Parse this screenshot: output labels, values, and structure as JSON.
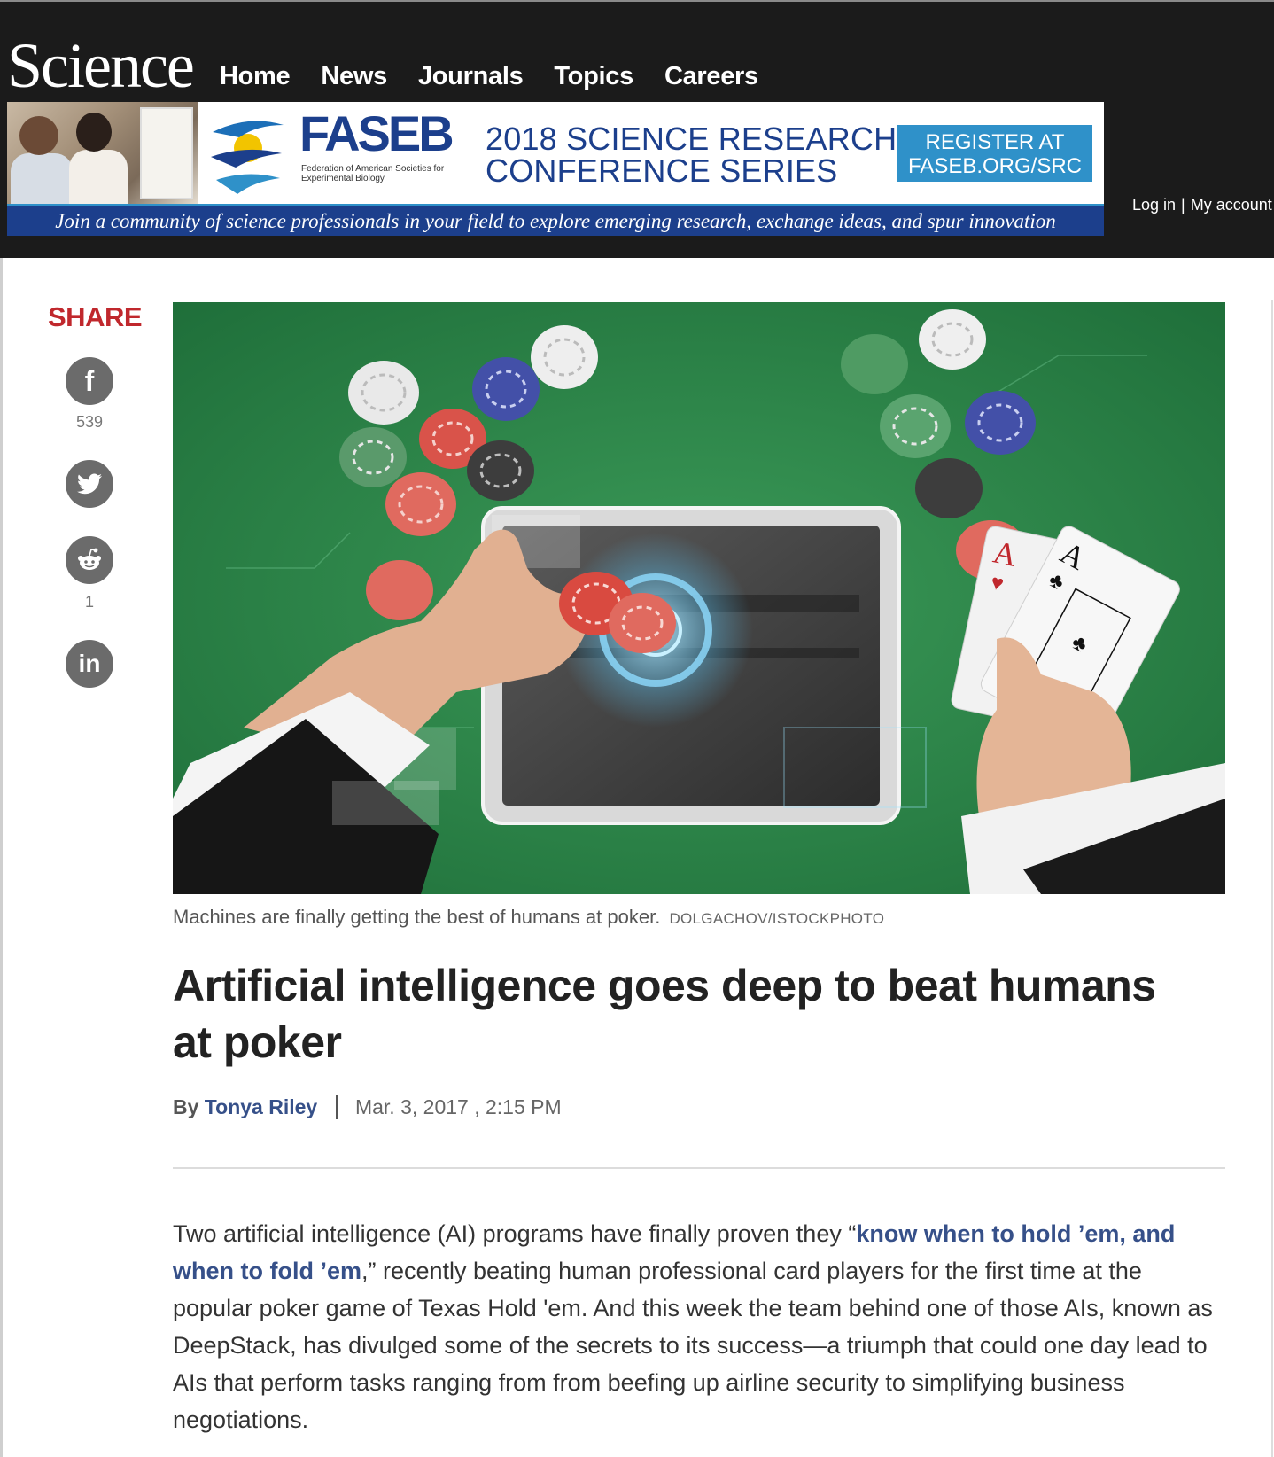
{
  "header": {
    "logo": "Science",
    "nav": [
      "Home",
      "News",
      "Journals",
      "Topics",
      "Careers"
    ],
    "login": "Log in",
    "separator": "|",
    "my_account": "My account"
  },
  "ad": {
    "brand": "FASEB",
    "brand_sub": "Federation of American Societies for Experimental Biology",
    "conference_line1": "2018 SCIENCE RESEARCH",
    "conference_line2": "CONFERENCE SERIES",
    "register_line1": "REGISTER AT",
    "register_line2": "FASEB.ORG/SRC",
    "tagline": "Join a community of science professionals in your field to explore emerging research, exchange ideas, and spur innovation"
  },
  "share": {
    "title": "SHARE",
    "facebook": {
      "icon": "facebook-icon",
      "glyph": "f",
      "count": "539"
    },
    "twitter": {
      "icon": "twitter-icon"
    },
    "reddit": {
      "icon": "reddit-icon",
      "count": "1"
    },
    "linkedin": {
      "icon": "linkedin-icon",
      "glyph": "in"
    }
  },
  "hero": {
    "card1_rank": "A",
    "card2_rank": "A"
  },
  "caption": {
    "text": "Machines are finally getting the best of humans at poker.",
    "credit": "DOLGACHOV/ISTOCKPHOTO"
  },
  "article": {
    "headline": "Artificial intelligence goes deep to beat humans at poker",
    "by": "By",
    "author": "Tonya Riley",
    "date": "Mar. 3, 2017 , 2:15 PM",
    "body_intro": "Two artificial intelligence (AI) programs have finally proven they “",
    "body_link": "know when to hold ’em, and when to fold ’em",
    "body_rest": ",” recently beating human professional card players for the first time at the popular poker game of Texas Hold 'em. And this week the team behind one of those AIs, known as DeepStack, has divulged some of the secrets to its success—a triumph that could one day lead to AIs that perform tasks ranging from from beefing up airline security to simplifying business negotiations."
  },
  "colors": {
    "header_bg": "#1b1b1b",
    "share_red": "#c0282d",
    "link_blue": "#365089",
    "faseb_blue": "#1c3f8c",
    "register_blue": "#2f91c9",
    "felt_green": "#2e8a4c"
  }
}
